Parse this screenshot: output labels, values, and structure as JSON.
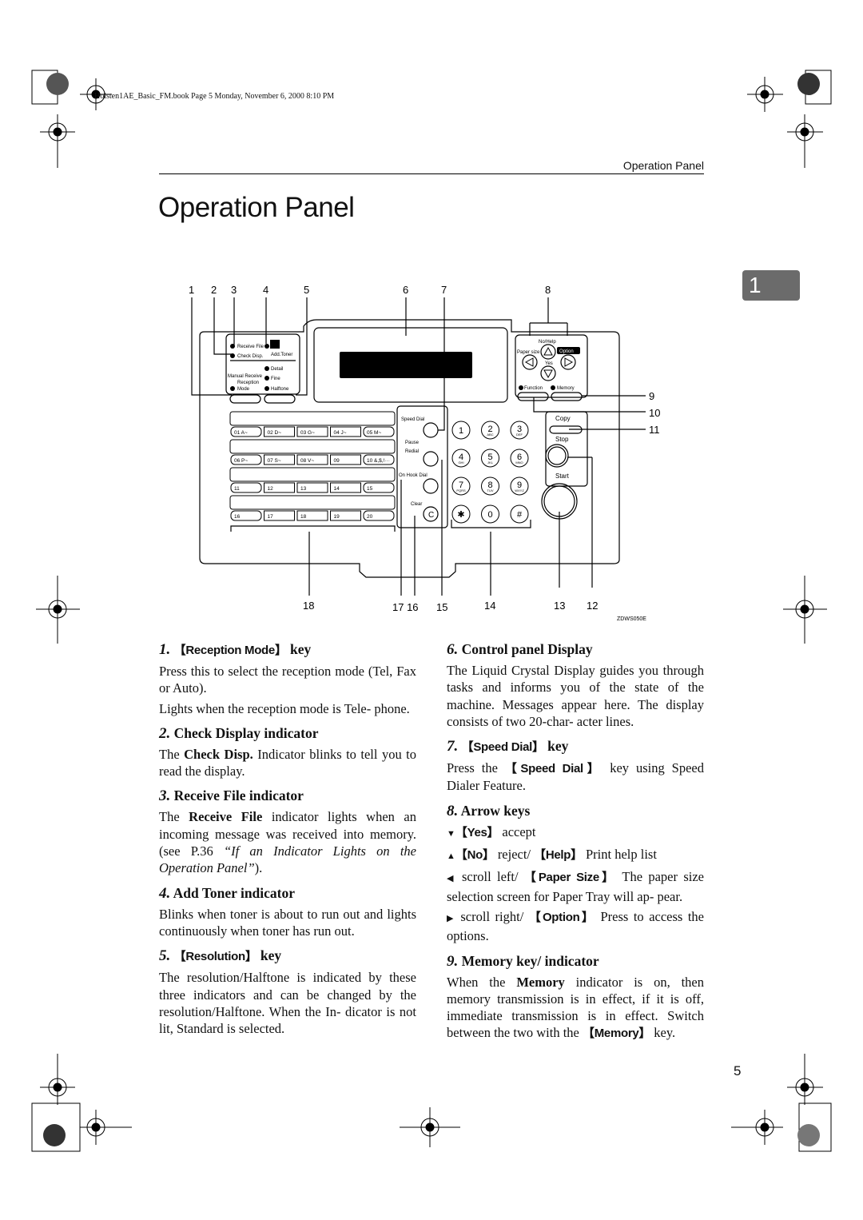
{
  "header": {
    "meta": "Holsten1AE_Basic_FM.book  Page 5  Monday, November 6, 2000  8:10 PM",
    "running_title": "Operation Panel"
  },
  "title": "Operation Panel",
  "chapter_tab": "1",
  "page_number": "5",
  "diagram": {
    "callouts": {
      "c1": "1",
      "c2": "2",
      "c3": "3",
      "c4": "4",
      "c5": "5",
      "c6": "6",
      "c7": "7",
      "c8": "8",
      "c9": "9",
      "c10": "10",
      "c11": "11",
      "c12": "12",
      "c13": "13",
      "c14": "14",
      "c15": "15",
      "c1716": "17 16",
      "c18": "18"
    },
    "code": "ZDWS050E",
    "labels": {
      "receive_file": "Receive File",
      "check_disp": "Check Disp.",
      "add_toner": "Add.Toner",
      "detail": "Detail",
      "fine": "Fine",
      "halftone": "Halftone",
      "manual_receive": "Manual Receive",
      "reception": "Reception",
      "mode": "Mode",
      "speed_dial": "Speed Dial",
      "pause": "Pause",
      "redial": "Redial",
      "on_hook_dial": "On Hook Dial",
      "clear": "Clear",
      "clear_key": "C",
      "no_help": "No/Help",
      "paper_size": "Paper size",
      "option": "Option",
      "yes": "Yes",
      "function": "Function",
      "memory": "Memory",
      "copy": "Copy",
      "stop": "Stop",
      "start": "Start"
    },
    "one_touch": [
      [
        "01  A~",
        "02  D~",
        "03  G~",
        "04  J~",
        "05  M~"
      ],
      [
        "06  P~",
        "07  S~",
        "08  V~",
        "09",
        "10 &,$,!···"
      ],
      [
        "11",
        "12",
        "13",
        "14",
        "15"
      ],
      [
        "16",
        "17",
        "18",
        "19",
        "20"
      ]
    ],
    "keypad": [
      [
        "1",
        ""
      ],
      [
        "2",
        "ABC"
      ],
      [
        "3",
        "DEF"
      ],
      [
        "4",
        "GHI"
      ],
      [
        "5",
        "JKL"
      ],
      [
        "6",
        "MNO"
      ],
      [
        "7",
        "PQRS"
      ],
      [
        "8",
        "TUV"
      ],
      [
        "9",
        "WXYZ"
      ],
      [
        "✱",
        ""
      ],
      [
        "0",
        ""
      ],
      [
        "#",
        ""
      ]
    ]
  },
  "sections": {
    "s1": {
      "num": "1.",
      "key": "【Reception Mode】",
      "suffix": " key",
      "p1": "Press this to select the reception mode (Tel, Fax or Auto).",
      "p2": "Lights when the reception mode is Tele- phone."
    },
    "s2": {
      "num": "2.",
      "title": " Check Display indicator",
      "p_a": "The ",
      "p_b": "Check Disp.",
      "p_c": " Indicator blinks to tell you to read the display."
    },
    "s3": {
      "num": "3.",
      "title": " Receive File indicator",
      "p_a": "The ",
      "p_b": "Receive File",
      "p_c": " indicator lights when an incoming message was received into memory. (see P.36 ",
      "p_d": "“If an Indicator Lights on the Operation Panel”",
      "p_e": ")."
    },
    "s4": {
      "num": "4.",
      "title": " Add Toner indicator",
      "p": "Blinks when toner is about to run out and lights continuously when toner has run out."
    },
    "s5": {
      "num": "5.",
      "key": "【Resolution】",
      "suffix": " key",
      "p": "The resolution/Halftone is indicated by these three indicators and can be changed by the resolution/Halftone. When the In- dicator is not lit, Standard is selected."
    },
    "s6": {
      "num": "6.",
      "title": " Control panel Display",
      "p": "The Liquid Crystal Display guides you through tasks and informs you of the state of the machine. Messages appear here. The display consists of two 20-char- acter lines."
    },
    "s7": {
      "num": "7.",
      "key": "【Speed Dial】",
      "suffix": " key",
      "p_a": "Press the ",
      "p_b": "【Speed Dial】",
      "p_c": " key using Speed Dialer Feature."
    },
    "s8": {
      "num": "8.",
      "title": " Arrow keys",
      "l1": {
        "icon": "▼",
        "key": "【Yes】",
        "text": " accept"
      },
      "l2": {
        "icon": "▲",
        "key": "【No】",
        "text": " reject/ ",
        "key2": "【Help】",
        "text2": " Print help list"
      },
      "l3": {
        "icon": "◀",
        "text": " scroll left/ ",
        "key": "【Paper Size】",
        "text2": " The paper size selection screen for Paper Tray will ap- pear."
      },
      "l4": {
        "icon": "▶",
        "text": " scroll right/ ",
        "key": "【Option】",
        "text2": " Press to access the options."
      }
    },
    "s9": {
      "num": "9.",
      "title": " Memory key/ indicator",
      "p_a": "When the ",
      "p_b": "Memory",
      "p_c": " indicator is on, then memory transmission is in effect, if it is off, immediate transmission is in effect. Switch between the two with the ",
      "p_d": "【Memory】",
      "p_e": " key."
    }
  }
}
